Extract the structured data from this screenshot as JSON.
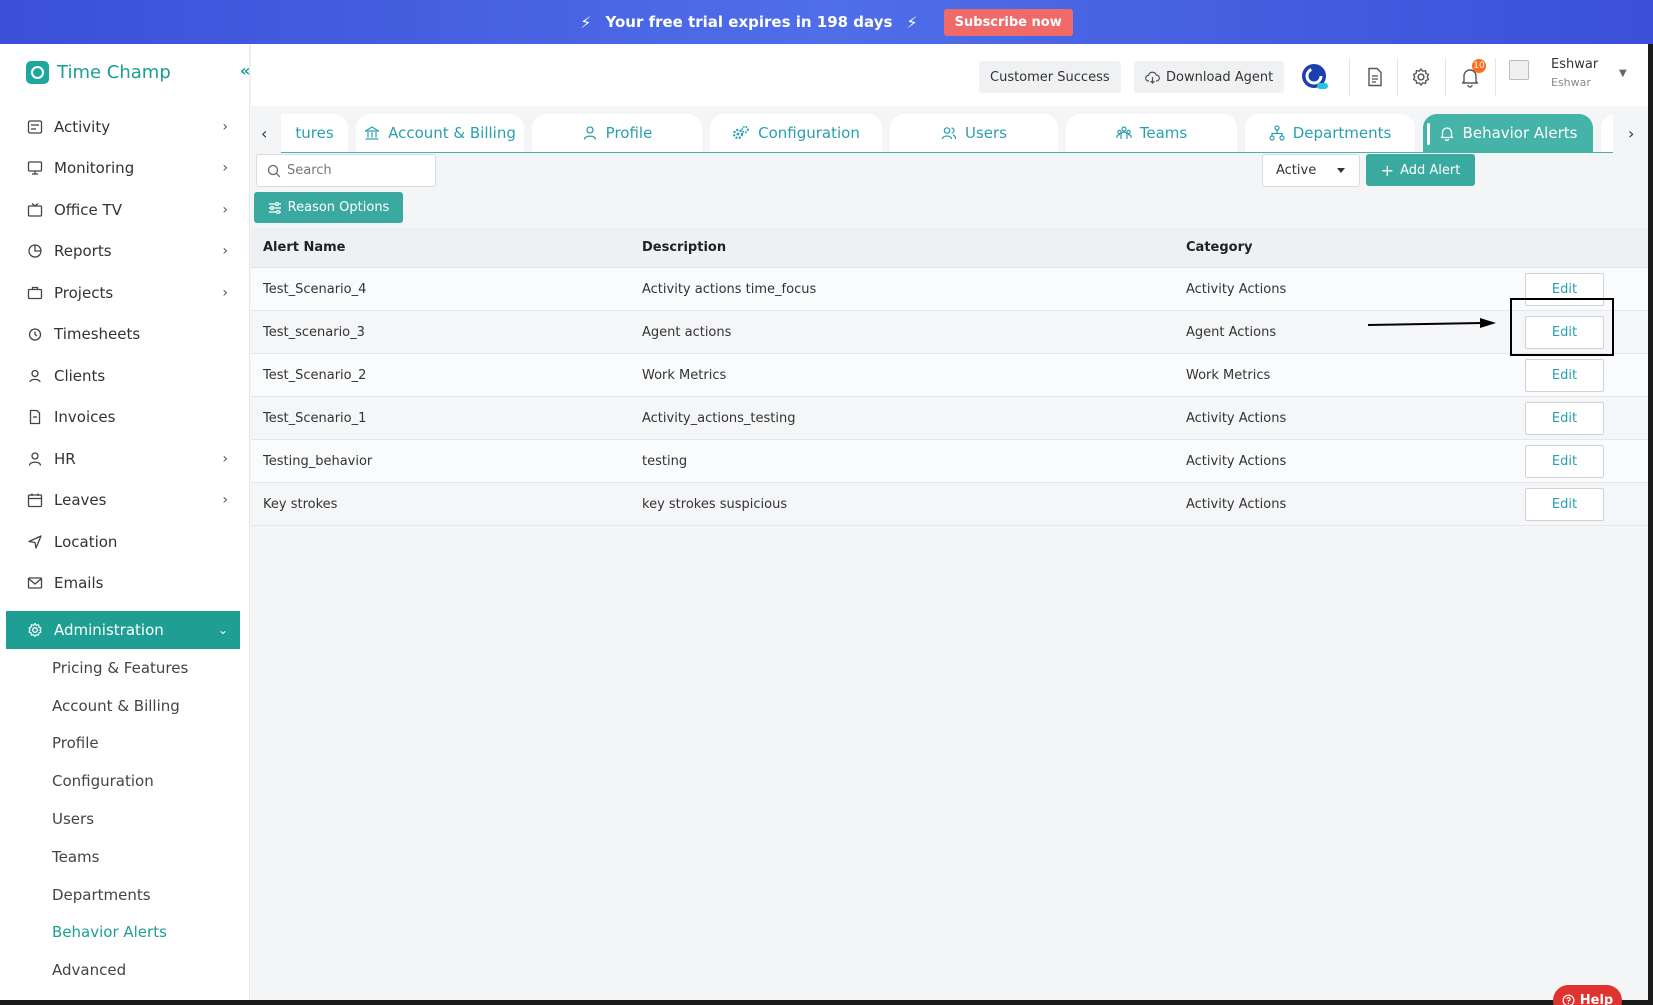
{
  "banner": {
    "trial_text": "Your free trial expires in 198 days",
    "subscribe_label": "Subscribe now"
  },
  "app": {
    "logo_text": "Time Champ"
  },
  "sidebar": {
    "items": [
      {
        "label": "Activity",
        "icon": "activity-icon",
        "has_chevron": true
      },
      {
        "label": "Monitoring",
        "icon": "monitor-icon",
        "has_chevron": true
      },
      {
        "label": "Office TV",
        "icon": "tv-icon",
        "has_chevron": true
      },
      {
        "label": "Reports",
        "icon": "pie-chart-icon",
        "has_chevron": true
      },
      {
        "label": "Projects",
        "icon": "briefcase-icon",
        "has_chevron": true
      },
      {
        "label": "Timesheets",
        "icon": "clock-icon",
        "has_chevron": false
      },
      {
        "label": "Clients",
        "icon": "client-icon",
        "has_chevron": false
      },
      {
        "label": "Invoices",
        "icon": "invoice-icon",
        "has_chevron": false
      },
      {
        "label": "HR",
        "icon": "person-icon",
        "has_chevron": true
      },
      {
        "label": "Leaves",
        "icon": "calendar-icon",
        "has_chevron": true
      },
      {
        "label": "Location",
        "icon": "location-icon",
        "has_chevron": false
      },
      {
        "label": "Emails",
        "icon": "mail-icon",
        "has_chevron": false
      }
    ],
    "admin_label": "Administration",
    "admin_sub": [
      {
        "label": "Pricing & Features"
      },
      {
        "label": "Account & Billing"
      },
      {
        "label": "Profile"
      },
      {
        "label": "Configuration"
      },
      {
        "label": "Users"
      },
      {
        "label": "Teams"
      },
      {
        "label": "Departments"
      },
      {
        "label": "Behavior Alerts",
        "active": true
      },
      {
        "label": "Advanced"
      }
    ]
  },
  "header": {
    "customer_success": "Customer Success",
    "download_agent": "Download Agent",
    "notif_count": "10",
    "user_name": "Eshwar",
    "user_sub": "Eshwar"
  },
  "tabs": [
    {
      "label": "tures"
    },
    {
      "label": "Account & Billing"
    },
    {
      "label": "Profile"
    },
    {
      "label": "Configuration"
    },
    {
      "label": "Users"
    },
    {
      "label": "Teams"
    },
    {
      "label": "Departments"
    },
    {
      "label": "Behavior Alerts",
      "active": true
    }
  ],
  "toolbar": {
    "search_placeholder": "Search",
    "status_value": "Active",
    "add_alert_label": "Add Alert",
    "reason_options_label": "Reason Options"
  },
  "table": {
    "columns": [
      "Alert Name",
      "Description",
      "Category"
    ],
    "edit_label": "Edit",
    "rows": [
      {
        "name": "Test_Scenario_4",
        "description": "Activity actions time_focus",
        "category": "Activity Actions"
      },
      {
        "name": "Test_scenario_3",
        "description": "Agent actions",
        "category": "Agent Actions"
      },
      {
        "name": "Test_Scenario_2",
        "description": "Work Metrics",
        "category": "Work Metrics"
      },
      {
        "name": "Test_Scenario_1",
        "description": "Activity_actions_testing",
        "category": "Activity Actions"
      },
      {
        "name": "Testing_behavior",
        "description": "testing",
        "category": "Activity Actions"
      },
      {
        "name": "Key strokes",
        "description": "key strokes suspicious",
        "category": "Activity Actions"
      }
    ]
  },
  "help_label": "Help",
  "colors": {
    "accent": "#1f9e94",
    "tab_text": "#2a9fb0",
    "banner": "#4460e0",
    "subscribe": "#f06a6a",
    "help": "#e0332f"
  }
}
